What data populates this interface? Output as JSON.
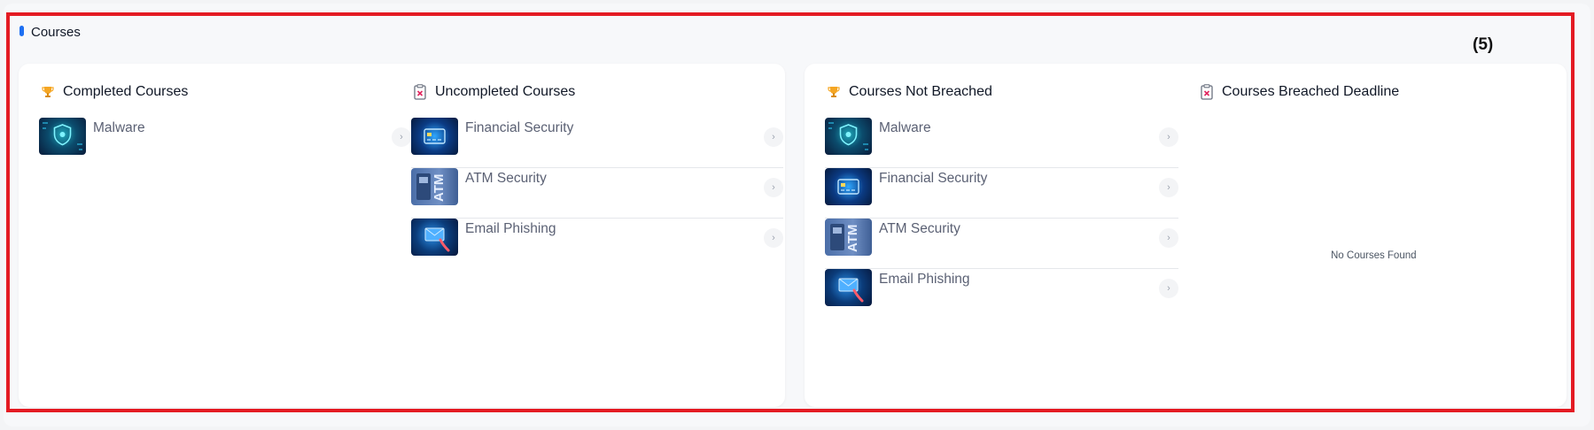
{
  "section": {
    "title": "Courses",
    "count": "(5)"
  },
  "left_card": {
    "completed": {
      "title": "Completed Courses",
      "items": [
        {
          "label": "Malware",
          "thumb": "malware"
        }
      ]
    },
    "uncompleted": {
      "title": "Uncompleted Courses",
      "items": [
        {
          "label": "Financial Security",
          "thumb": "financial"
        },
        {
          "label": "ATM Security",
          "thumb": "atm"
        },
        {
          "label": "Email Phishing",
          "thumb": "email"
        }
      ]
    }
  },
  "right_card": {
    "not_breached": {
      "title": "Courses Not Breached",
      "items": [
        {
          "label": "Malware",
          "thumb": "malware"
        },
        {
          "label": "Financial Security",
          "thumb": "financial"
        },
        {
          "label": "ATM Security",
          "thumb": "atm"
        },
        {
          "label": "Email Phishing",
          "thumb": "email"
        }
      ]
    },
    "breached": {
      "title": "Courses Breached Deadline",
      "empty_text": "No Courses Found"
    }
  },
  "icons": {
    "trophy": "trophy-icon",
    "clipboard": "clipboard-x-icon",
    "chevron": "chevron-right-icon"
  },
  "colors": {
    "accent": "#1d6ff2",
    "highlight": "#e41b23",
    "trophy": "#f5a623",
    "danger": "#e0245e"
  }
}
